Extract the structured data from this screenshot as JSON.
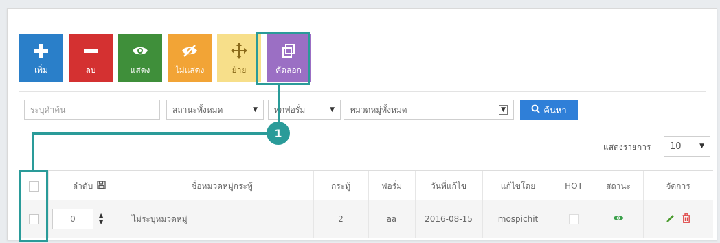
{
  "toolbar": {
    "add": {
      "label": "เพิ่ม",
      "icon": "plus-icon"
    },
    "delete": {
      "label": "ลบ",
      "icon": "minus-icon"
    },
    "show": {
      "label": "แสดง",
      "icon": "eye-icon"
    },
    "hide": {
      "label": "ไม่แสดง",
      "icon": "eye-slash-icon"
    },
    "move": {
      "label": "ย้าย",
      "icon": "move-arrows-icon"
    },
    "copy": {
      "label": "คัดลอก",
      "icon": "copy-icon"
    }
  },
  "filters": {
    "keyword_placeholder": "ระบุคำค้น",
    "status_selected": "สถานะทั้งหมด",
    "forum_selected": "ทุกฟอรั่ม",
    "category_selected": "หมวดหมู่ทั้งหมด",
    "search_label": "ค้นหา"
  },
  "annotation": {
    "marker": "1",
    "color": "#2a9b99"
  },
  "pagination": {
    "label": "แสดงรายการ",
    "per_page": "10"
  },
  "table": {
    "headers": {
      "order": "ลำดับ",
      "name": "ชื่อหมวดหมู่กระทู้",
      "threads": "กระทู้",
      "forum": "ฟอรั่ม",
      "edited_date": "วันที่แก้ไข",
      "edited_by": "แก้ไขโดย",
      "hot": "HOT",
      "status": "สถานะ",
      "actions": "จัดการ"
    },
    "rows": [
      {
        "order": "0",
        "name": "ไม่ระบุหมวดหมู่",
        "threads": "2",
        "forum": "aa",
        "edited_date": "2016-08-15",
        "edited_by": "mospichit",
        "hot": false,
        "status": "visible"
      }
    ]
  },
  "colors": {
    "add": "#2a7fc9",
    "delete": "#d43131",
    "show": "#3f8f3a",
    "hide": "#f2a436",
    "move": "#f7df8a",
    "copy": "#9b6fc4",
    "search": "#2f7fd8"
  }
}
